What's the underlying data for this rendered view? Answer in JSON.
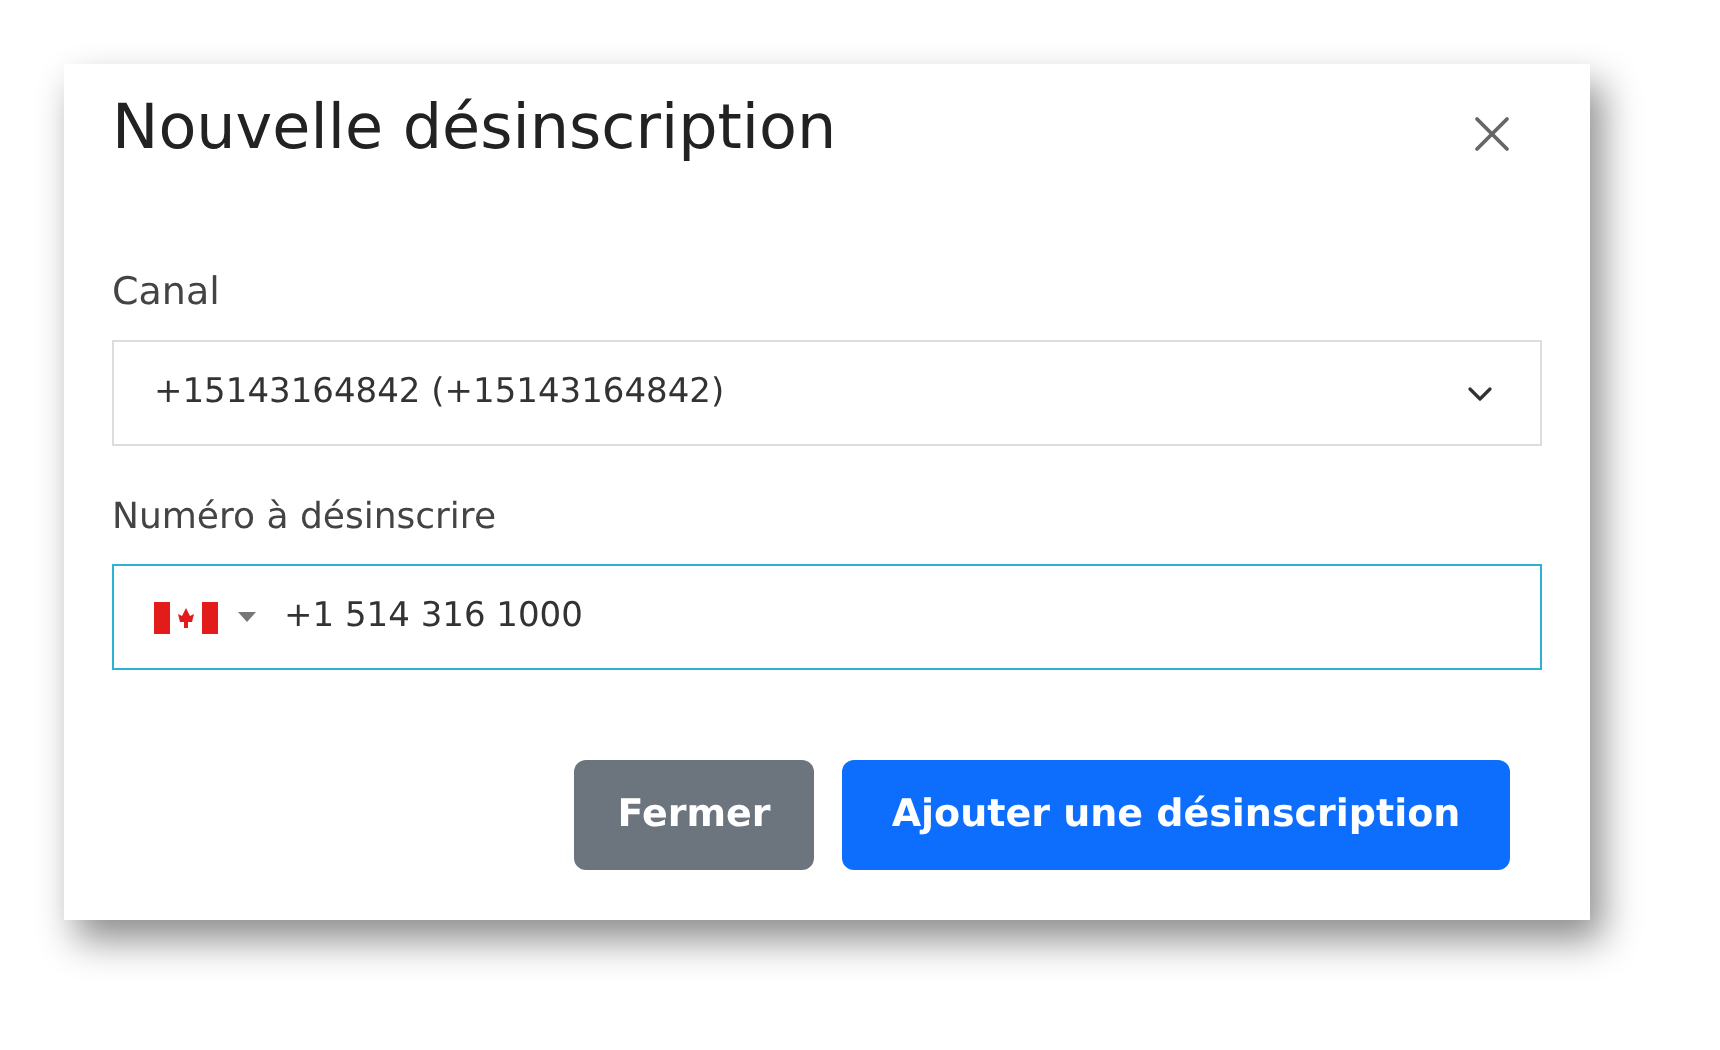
{
  "dialog": {
    "title": "Nouvelle désinscription"
  },
  "channel": {
    "label": "Canal",
    "value": "+15143164842 (+15143164842)"
  },
  "number": {
    "label": "Numéro à désinscrire",
    "value": "+1 514 316 1000",
    "focused": true
  },
  "buttons": [
    {
      "label": "Fermer",
      "kind": "secondary"
    },
    {
      "label": "Ajouter une désinscription",
      "kind": "primary"
    }
  ]
}
